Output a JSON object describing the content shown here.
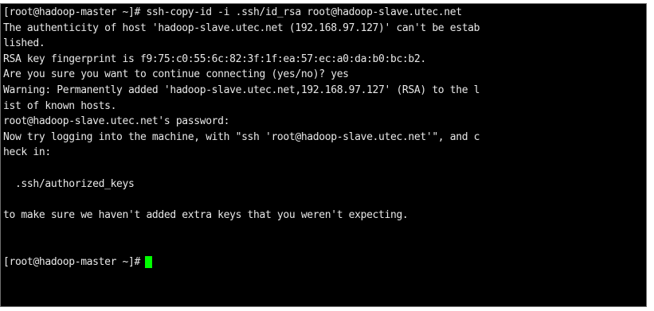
{
  "terminal": {
    "lines": [
      "[root@hadoop-master ~]# ssh-copy-id -i .ssh/id_rsa root@hadoop-slave.utec.net",
      "The authenticity of host 'hadoop-slave.utec.net (192.168.97.127)' can't be estab",
      "lished.",
      "RSA key fingerprint is f9:75:c0:55:6c:82:3f:1f:ea:57:ec:a0:da:b0:bc:b2.",
      "Are you sure you want to continue connecting (yes/no)? yes",
      "Warning: Permanently added 'hadoop-slave.utec.net,192.168.97.127' (RSA) to the l",
      "ist of known hosts.",
      "root@hadoop-slave.utec.net's password:",
      "Now try logging into the machine, with \"ssh 'root@hadoop-slave.utec.net'\", and c",
      "heck in:",
      "",
      "  .ssh/authorized_keys",
      "",
      "to make sure we haven't added extra keys that you weren't expecting.",
      "",
      "",
      "[root@hadoop-master ~]#"
    ],
    "colors": {
      "background": "#000000",
      "foreground": "#e8e8e8",
      "cursor": "#00ff00"
    }
  }
}
